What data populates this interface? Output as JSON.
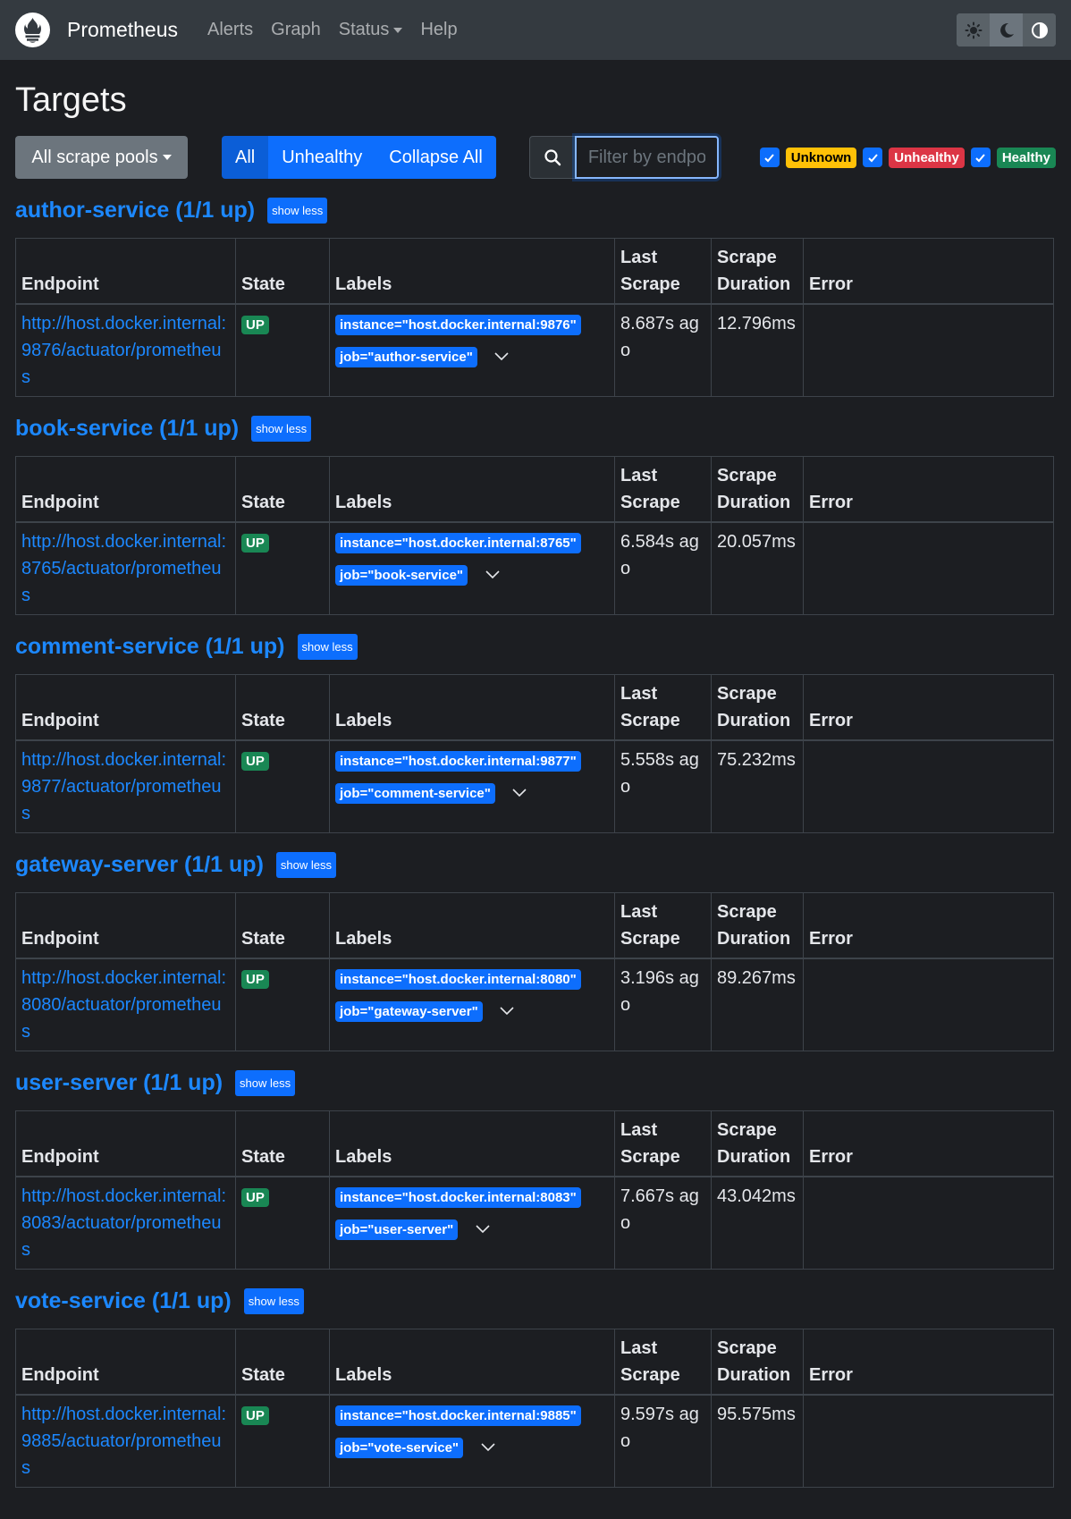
{
  "navbar": {
    "brand": "Prometheus",
    "items": [
      "Alerts",
      "Graph",
      "Status",
      "Help"
    ]
  },
  "page": {
    "title": "Targets",
    "pools_button": "All scrape pools",
    "seg_all": "All",
    "seg_unhealthy": "Unhealthy",
    "seg_collapse": "Collapse All",
    "search_placeholder": "Filter by endpoint or labels",
    "filter_unknown": "Unknown",
    "filter_unhealthy": "Unhealthy",
    "filter_healthy": "Healthy"
  },
  "table_headers": {
    "endpoint": "Endpoint",
    "state": "State",
    "labels": "Labels",
    "last_scrape": "Last Scrape",
    "scrape_duration": "Scrape Duration",
    "error": "Error"
  },
  "show_less": "show less",
  "pools": [
    {
      "title": "author-service (1/1 up)",
      "endpoint": "http://host.docker.internal:9876/actuator/prometheus",
      "state": "UP",
      "instance": "instance=\"host.docker.internal:9876\"",
      "job": "job=\"author-service\"",
      "last_scrape": "8.687s ago",
      "duration": "12.796ms",
      "error": ""
    },
    {
      "title": "book-service (1/1 up)",
      "endpoint": "http://host.docker.internal:8765/actuator/prometheus",
      "state": "UP",
      "instance": "instance=\"host.docker.internal:8765\"",
      "job": "job=\"book-service\"",
      "last_scrape": "6.584s ago",
      "duration": "20.057ms",
      "error": ""
    },
    {
      "title": "comment-service (1/1 up)",
      "endpoint": "http://host.docker.internal:9877/actuator/prometheus",
      "state": "UP",
      "instance": "instance=\"host.docker.internal:9877\"",
      "job": "job=\"comment-service\"",
      "last_scrape": "5.558s ago",
      "duration": "75.232ms",
      "error": ""
    },
    {
      "title": "gateway-server (1/1 up)",
      "endpoint": "http://host.docker.internal:8080/actuator/prometheus",
      "state": "UP",
      "instance": "instance=\"host.docker.internal:8080\"",
      "job": "job=\"gateway-server\"",
      "last_scrape": "3.196s ago",
      "duration": "89.267ms",
      "error": ""
    },
    {
      "title": "user-server (1/1 up)",
      "endpoint": "http://host.docker.internal:8083/actuator/prometheus",
      "state": "UP",
      "instance": "instance=\"host.docker.internal:8083\"",
      "job": "job=\"user-server\"",
      "last_scrape": "7.667s ago",
      "duration": "43.042ms",
      "error": ""
    },
    {
      "title": "vote-service (1/1 up)",
      "endpoint": "http://host.docker.internal:9885/actuator/prometheus",
      "state": "UP",
      "instance": "instance=\"host.docker.internal:9885\"",
      "job": "job=\"vote-service\"",
      "last_scrape": "9.597s ago",
      "duration": "95.575ms",
      "error": ""
    }
  ]
}
